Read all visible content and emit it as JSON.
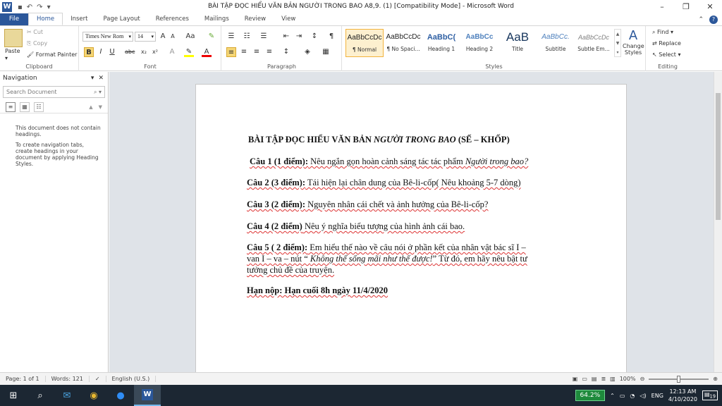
{
  "window": {
    "title": "BÀI TẬP ĐỌC HIỂU VĂN BẢN NGƯỜI TRONG BAO A8,9. (1) [Compatibility Mode]  -  Microsoft Word",
    "app_icon": "W",
    "controls": {
      "minimize": "–",
      "maximize": "❐",
      "close": "✕"
    }
  },
  "tabs": [
    "File",
    "Home",
    "Insert",
    "Page Layout",
    "References",
    "Mailings",
    "Review",
    "View"
  ],
  "active_tab": "Home",
  "ribbon": {
    "clipboard": {
      "label": "Clipboard",
      "paste": "Paste",
      "cut": "Cut",
      "copy": "Copy",
      "format_painter": "Format Painter"
    },
    "font": {
      "label": "Font",
      "name": "Times New Rom",
      "size": "14"
    },
    "paragraph": {
      "label": "Paragraph"
    },
    "styles": {
      "label": "Styles",
      "items": [
        {
          "preview": "AaBbCcDc",
          "name": "¶ Normal"
        },
        {
          "preview": "AaBbCcDc",
          "name": "¶ No Spaci..."
        },
        {
          "preview": "AaBbC(",
          "name": "Heading 1"
        },
        {
          "preview": "AaBbCc",
          "name": "Heading 2"
        },
        {
          "preview": "AaB",
          "name": "Title"
        },
        {
          "preview": "AaBbCc.",
          "name": "Subtitle"
        },
        {
          "preview": "AaBbCcDc",
          "name": "Subtle Em..."
        }
      ],
      "change_styles": "Change Styles"
    },
    "editing": {
      "label": "Editing",
      "find": "Find",
      "replace": "Replace",
      "select": "Select"
    }
  },
  "nav": {
    "title": "Navigation",
    "search_placeholder": "Search Document",
    "message1": "This document does not contain headings.",
    "message2": "To create navigation tabs, create headings in your document by applying Heading Styles."
  },
  "document": {
    "title_plain": "BÀI TẬP ĐỌC HIỂU VĂN BẢN ",
    "title_italic": "NGƯỜI TRONG BAO",
    "title_suffix": " (SẾ – KHỐP)",
    "q1_label": "Câu 1 (1 điểm):",
    "q1_text": " Nêu ngắn gọn hoàn cảnh sáng tác tác phẩm ",
    "q1_italic": "Người trong bao?",
    "q2_label": "Câu 2 (3 điểm):",
    "q2_text": " Tái hiện lại chân dung của Bê-li-cốp( Nêu khoảng 5-7 dòng)",
    "q3_label": "Câu 3 (2 điểm):",
    "q3_text": " Nguyên nhân cái chết và ảnh hưởng của Bê-li-cốp?",
    "q4_label": "Câu 4 (2 điểm)",
    "q4_text": " Nêu ý nghĩa biểu tượng của hình ảnh cái bao.",
    "q5_label": "Câu 5 ( 2 điểm):",
    "q5_text1": "  Em hiểu thế nào về câu nói ở phần kết của nhân vật  bác sĩ  I –",
    "q5_text2a": "van  I – va – nút “ ",
    "q5_italic": "Không thể sống mãi như thế được!",
    "q5_text2b": "”  Từ đó, em hãy nêu bật tư",
    "q5_text3": "tưởng chủ đề  của truyện.",
    "deadline": "Hạn nộp:  Hạn cuối 8h ngày 11/4/2020"
  },
  "status": {
    "page": "Page: 1 of 1",
    "words": "Words: 121",
    "language": "English (U.S.)",
    "zoom": "100%",
    "zoom_level": 0.5
  },
  "taskbar": {
    "battery": "64.2%",
    "lang": "ENG",
    "time": "12:13 AM",
    "date": "4/10/2020",
    "notifications": "19"
  }
}
